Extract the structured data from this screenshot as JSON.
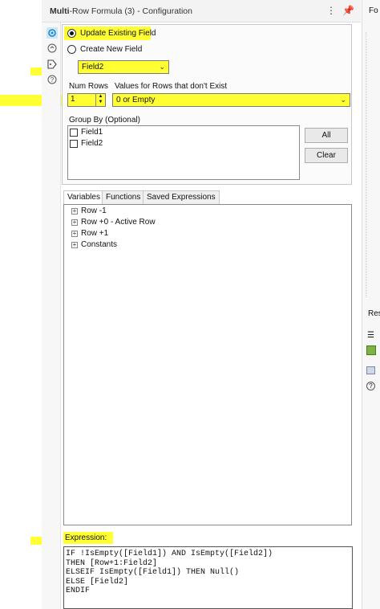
{
  "header": {
    "title_bold": "Multi",
    "title_rest": "-Row Formula (3) - Configuration",
    "menu_icon": "more-vert-icon",
    "pin_icon": "pin-icon"
  },
  "sidebar_icons": [
    "gear-icon",
    "anchor-icon",
    "tag-icon",
    "help-icon"
  ],
  "mode": {
    "update_label": "Update Existing Field",
    "create_label": "Create New  Field",
    "selected": "update"
  },
  "field_select": {
    "value": "Field2"
  },
  "num_rows": {
    "label": "Num Rows",
    "value": "1"
  },
  "missing_rows": {
    "label": "Values for Rows that don't Exist",
    "value": "0 or Empty"
  },
  "group_by": {
    "label": "Group By (Optional)",
    "fields": [
      "Field1",
      "Field2"
    ],
    "all_label": "All",
    "clear_label": "Clear"
  },
  "tabs": [
    "Variables",
    "Functions",
    "Saved Expressions"
  ],
  "tree": [
    "Row -1",
    "Row +0 - Active Row",
    "Row +1",
    "Constants"
  ],
  "expression": {
    "label": "Expression:",
    "lines": [
      "IF !IsEmpty([Field1]) AND IsEmpty([Field2])",
      "THEN [Row+1:Field2]",
      "ELSEIF IsEmpty([Field1]) THEN Null()",
      "ELSE [Field2]",
      "ENDIF"
    ]
  },
  "right_panel": {
    "tab1": "Fo",
    "tab2": "Res"
  },
  "colors": {
    "highlight": "#ffff33",
    "accent": "#1e88d4",
    "green": "#7cb342"
  }
}
